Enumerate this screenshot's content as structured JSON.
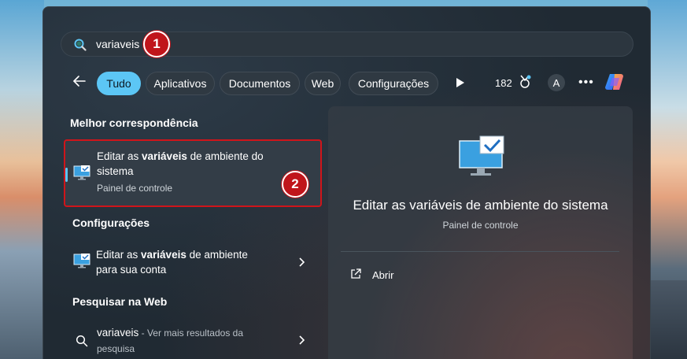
{
  "search": {
    "value": "variaveis",
    "icon": "search-icon"
  },
  "markers": [
    "1",
    "2"
  ],
  "filters": {
    "back": "arrow-left-icon",
    "chips": [
      {
        "label": "Tudo",
        "active": true
      },
      {
        "label": "Aplicativos",
        "active": false
      },
      {
        "label": "Documentos",
        "active": false
      },
      {
        "label": "Web",
        "active": false
      },
      {
        "label": "Configurações",
        "active": false
      }
    ],
    "points": "182",
    "account_initial": "A",
    "more": "•••"
  },
  "results": {
    "best_match_heading": "Melhor correspondência",
    "best_match": {
      "line1_prefix": "Editar as ",
      "line1_bold": "variáveis",
      "line1_suffix": " de ambiente do",
      "line2": "sistema",
      "subtitle": "Painel de controle"
    },
    "settings_heading": "Configurações",
    "settings_item": {
      "line1_prefix": "Editar as ",
      "line1_bold": "variáveis",
      "line1_suffix": " de ambiente",
      "line2": "para sua conta"
    },
    "web_heading": "Pesquisar na Web",
    "web_item": {
      "query": "variaveis",
      "muted": " - Ver mais resultados da",
      "line2": "pesquisa"
    }
  },
  "detail": {
    "title": "Editar as variáveis de ambiente do sistema",
    "subtitle": "Painel de controle",
    "action_open": "Abrir"
  },
  "colors": {
    "accent": "#5cc6f5",
    "highlight": "#d0141a",
    "panel": "#202a33"
  }
}
